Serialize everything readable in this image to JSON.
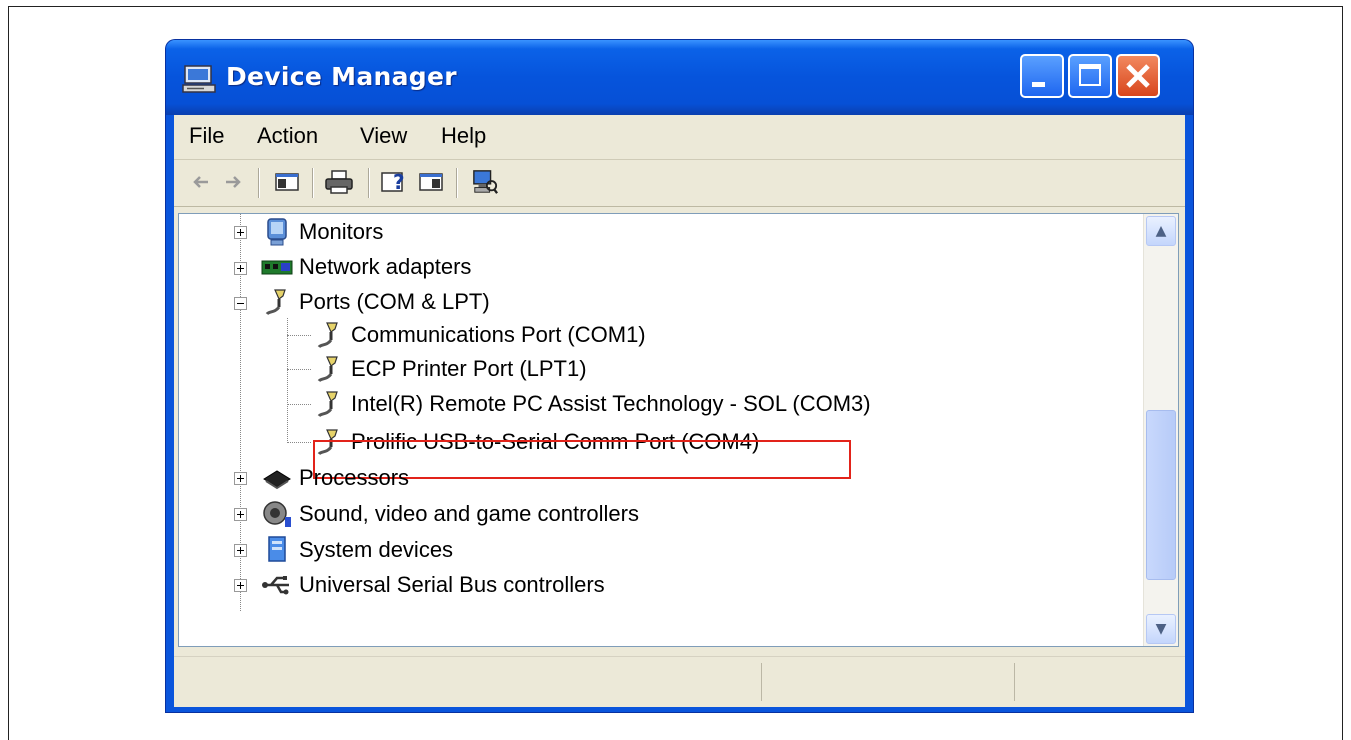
{
  "window": {
    "title": "Device Manager"
  },
  "menu": {
    "items": [
      "File",
      "Action",
      "View",
      "Help"
    ]
  },
  "toolbar": {
    "icons": [
      "back-arrow-icon",
      "forward-arrow-icon",
      "show-hide-console-tree-icon",
      "print-icon",
      "help-icon",
      "properties-icon",
      "scan-hardware-icon"
    ]
  },
  "tree": {
    "nodes": [
      {
        "label": "Monitors",
        "icon": "monitor-icon",
        "expanded": false
      },
      {
        "label": "Network adapters",
        "icon": "network-adapter-icon",
        "expanded": false
      },
      {
        "label": "Ports (COM & LPT)",
        "icon": "port-connector-icon",
        "expanded": true
      },
      {
        "label": "Communications Port (COM1)",
        "icon": "port-connector-icon"
      },
      {
        "label": "ECP Printer Port (LPT1)",
        "icon": "port-connector-icon"
      },
      {
        "label": "Intel(R) Remote PC Assist Technology - SOL (COM3)",
        "icon": "port-connector-icon"
      },
      {
        "label": "Prolific USB-to-Serial Comm Port (COM4)",
        "icon": "port-connector-icon",
        "highlighted": true
      },
      {
        "label": "Processors",
        "icon": "processor-icon",
        "expanded": false
      },
      {
        "label": "Sound, video and game controllers",
        "icon": "speaker-icon",
        "expanded": false
      },
      {
        "label": "System devices",
        "icon": "system-device-icon",
        "expanded": false
      },
      {
        "label": "Universal Serial Bus controllers",
        "icon": "usb-icon",
        "expanded": false
      }
    ],
    "highlight_color": "#e2231a"
  },
  "colors": {
    "titlebar": "#0654dc",
    "close_button": "#d8461c",
    "client_bg": "#ece9d8"
  }
}
